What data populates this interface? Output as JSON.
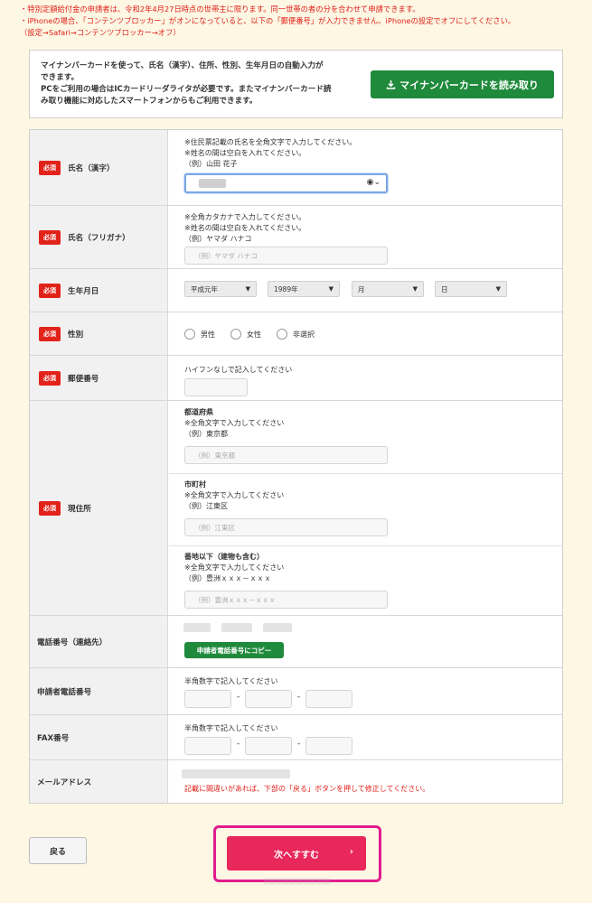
{
  "notices": [
    "・特別定額給付金の申請者は、令和2年4月27日時点の世帯主に限ります。同一世帯の者の分を合わせて申請できます。",
    "・iPhoneの場合、「コンテンツブロッカー」がオンになっていると、以下の「郵便番号」が入力できません。iPhoneの設定でオフにしてください。",
    "（設定→Safari→コンテンツブロッカー→オフ）"
  ],
  "mynumber": {
    "lines": [
      "マイナンバーカードを使って、氏名（漢字）、住所、性別、生年月日の自動入力が",
      "できます。",
      "PCをご利用の場合はICカードリーダライタが必要です。またマイナンバーカード読",
      "み取り機能に対応したスマートフォンからもご利用できます。"
    ],
    "button_label": "マイナンバーカードを読み取り",
    "button_icon": "download-icon"
  },
  "required_label": "必須",
  "name_kanji": {
    "label": "氏名（漢字）",
    "hints": [
      "※住民票記載の氏名を全角文字で入力してください。",
      "※姓名の間は空白を入れてください。",
      "（例）山田 花子"
    ],
    "input_icon": "autofill-person-icon"
  },
  "name_kana": {
    "label": "氏名（フリガナ）",
    "hints": [
      "※全角カタカナで入力してください。",
      "※姓名の間は空白を入れてください。",
      "（例）ヤマダ ハナコ"
    ],
    "placeholder": "（例）ヤマダ ハナコ"
  },
  "birthdate": {
    "label": "生年月日",
    "era": "平成元年",
    "year": "1989年",
    "month": "月",
    "day": "日"
  },
  "gender": {
    "label": "性別",
    "options": [
      "男性",
      "女性",
      "非選択"
    ]
  },
  "postal": {
    "label": "郵便番号",
    "hint": "ハイフンなしで記入してください"
  },
  "address": {
    "label": "現住所",
    "prefecture": {
      "title": "都道府県",
      "hints": [
        "※全角文字で入力してください",
        "（例）東京都"
      ],
      "placeholder": "（例）東京都"
    },
    "city": {
      "title": "市町村",
      "hints": [
        "※全角文字で入力してください",
        "（例）江東区"
      ],
      "placeholder": "（例）江東区"
    },
    "street": {
      "title": "番地以下（建物も含む）",
      "hints": [
        "※全角文字で入力してください",
        "（例）豊洲ｘｘｘ－ｘｘｘ"
      ],
      "placeholder": "（例）豊洲ｘｘｘ－ｘｘｘ"
    }
  },
  "contact_phone": {
    "label": "電話番号（連絡先）",
    "copy_button": "申請者電話番号にコピー"
  },
  "applicant_phone": {
    "label": "申請者電話番号",
    "hint": "半角数字で記入してください",
    "separator": "-"
  },
  "fax": {
    "label": "FAX番号",
    "hint": "半角数字で記入してください",
    "separator": "-"
  },
  "email": {
    "label": "メールアドレス",
    "note": "記載に間違いがあれば、下部の「戻る」ボタンを押して修正してください。"
  },
  "footer": {
    "back_label": "戻る",
    "next_label": "次へすすむ",
    "next_icon": "chevron-right-icon",
    "accent": "#e8275a",
    "highlight_color": "#e21c8f"
  }
}
